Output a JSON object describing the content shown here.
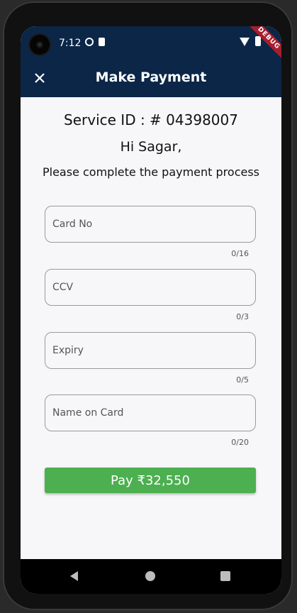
{
  "status_bar": {
    "time": "7:12",
    "debug_banner": "DEBUG"
  },
  "app_bar": {
    "title": "Make Payment",
    "close_icon": "close-icon"
  },
  "content": {
    "service_id": "Service ID : # 04398007",
    "greeting": "Hi Sagar,",
    "instruction": "Please complete the payment process"
  },
  "form": {
    "card_no": {
      "placeholder": "Card No",
      "value": "",
      "counter": "0/16"
    },
    "ccv": {
      "placeholder": "CCV",
      "value": "",
      "counter": "0/3"
    },
    "expiry": {
      "placeholder": "Expiry",
      "value": "",
      "counter": "0/5"
    },
    "name_on_card": {
      "placeholder": "Name on Card",
      "value": "",
      "counter": "0/20"
    }
  },
  "pay_button": {
    "label": "Pay  ₹32,550",
    "color": "#4caf50"
  },
  "colors": {
    "app_bar": "#0b2647",
    "background": "#f7f7f9"
  },
  "nav_bar": {
    "icons": [
      "back-icon",
      "home-icon",
      "recents-icon"
    ]
  }
}
